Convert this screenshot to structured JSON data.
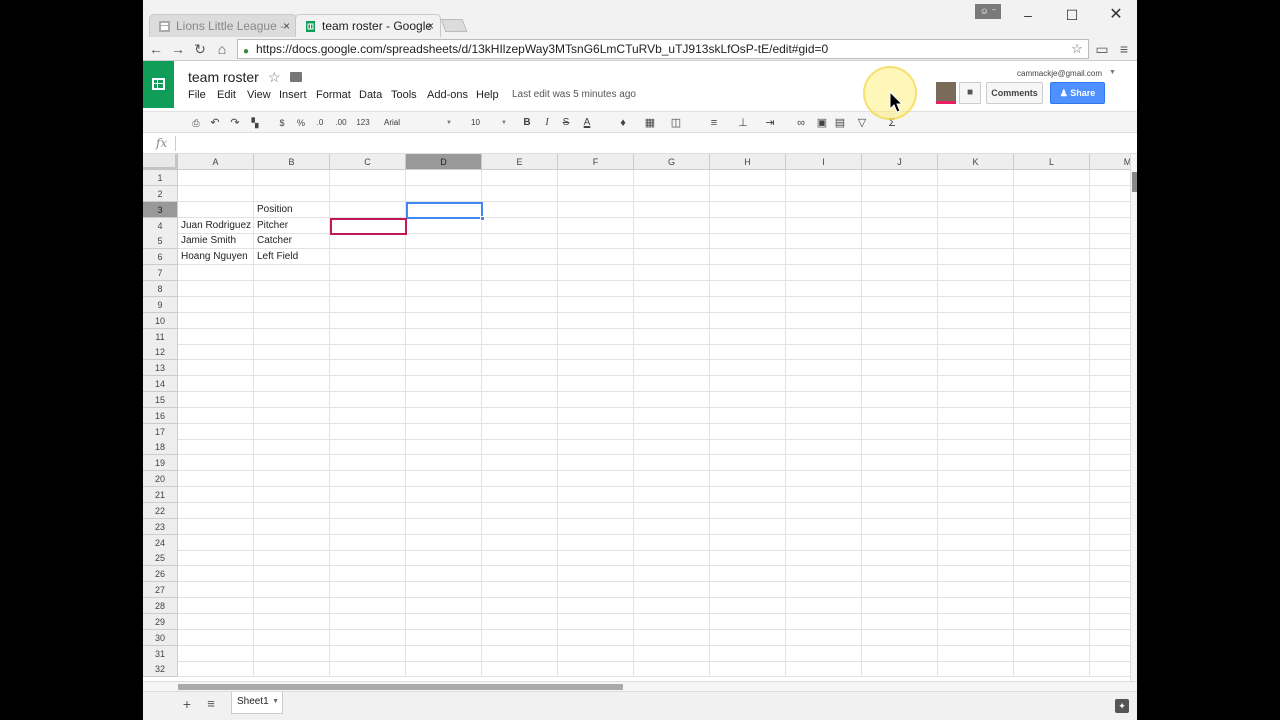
{
  "browser": {
    "tabs": [
      {
        "title": "Lions Little League -",
        "close": "×",
        "favicon": "sites-icon"
      },
      {
        "title": "team roster - Google",
        "close": "×",
        "favicon": "sheets-icon"
      }
    ],
    "profile_label": "☺ ⁻",
    "url": "https://docs.google.com/spreadsheets/d/13kHIlzepWay3MTsnG6LmCTuRVb_uTJ913skLfOsP-tE/edit#gid=0"
  },
  "doc": {
    "title": "team roster",
    "menus": [
      "File",
      "Edit",
      "View",
      "Insert",
      "Format",
      "Data",
      "Tools",
      "Add-ons",
      "Help"
    ],
    "last_edit": "Last edit was 5 minutes ago",
    "account": "cammackje@gmail.com",
    "comments_label": "Comments",
    "share_label": "Share"
  },
  "toolbar": {
    "currency": "$",
    "percent": "%",
    "dec_less": ".0",
    "dec_more": ".00",
    "more_formats": "123",
    "font": "Arial",
    "font_size": "10",
    "bold": "B",
    "italic": "I",
    "strike": "S",
    "text_color": "A"
  },
  "formula": {
    "fx": "fx",
    "value": ""
  },
  "grid": {
    "columns": [
      "A",
      "B",
      "C",
      "D",
      "E",
      "F",
      "G",
      "H",
      "I",
      "J",
      "K",
      "L",
      "M"
    ],
    "selected_column": "D",
    "selected_row": 3,
    "row_count": 32,
    "cells": {
      "B3": "Position",
      "A4": "Juan Rodriguez",
      "B4": "Pitcher",
      "A5": "Jamie Smith",
      "B5": "Catcher",
      "A6": "Hoang Nguyen",
      "B6": "Left Field"
    }
  },
  "sheets": {
    "add": "+",
    "list": "≡",
    "tabs": [
      "Sheet1"
    ]
  },
  "colors": {
    "sheets_green": "#0f9d58",
    "share_blue": "#4d90fe",
    "selection_blue": "#4285f4",
    "collaborator_pink": "#c2185b"
  }
}
